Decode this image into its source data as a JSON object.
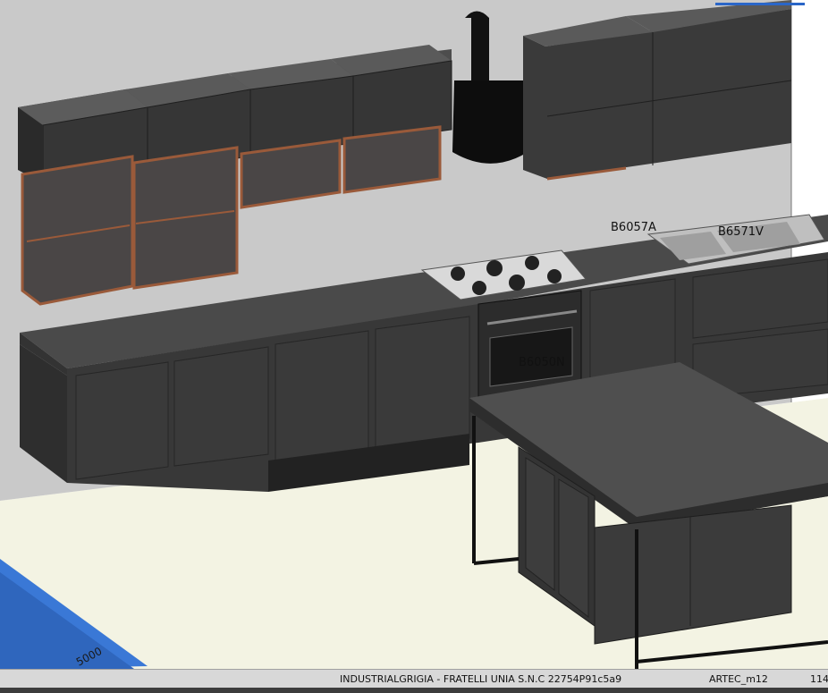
{
  "viewport": {
    "dimension_label": "5000",
    "element_codes": {
      "upper_right": "B6057A",
      "sink": "B6571V",
      "oven": "B6050N"
    }
  },
  "statusbar": {
    "project": "INDUSTRIALGRIGIA - FRATELLI UNIA S.N.C 22754P91c5a9",
    "user": "ARTEC_m12",
    "extra": "114"
  },
  "colors": {
    "wall": "#c9c9c9",
    "floor": "#f3f3e3",
    "cabinet": "#3d3d3d",
    "countertop": "#4a4a4a",
    "copper_frame": "#9a5a3a",
    "dimension_blue": "#3a78d6"
  }
}
